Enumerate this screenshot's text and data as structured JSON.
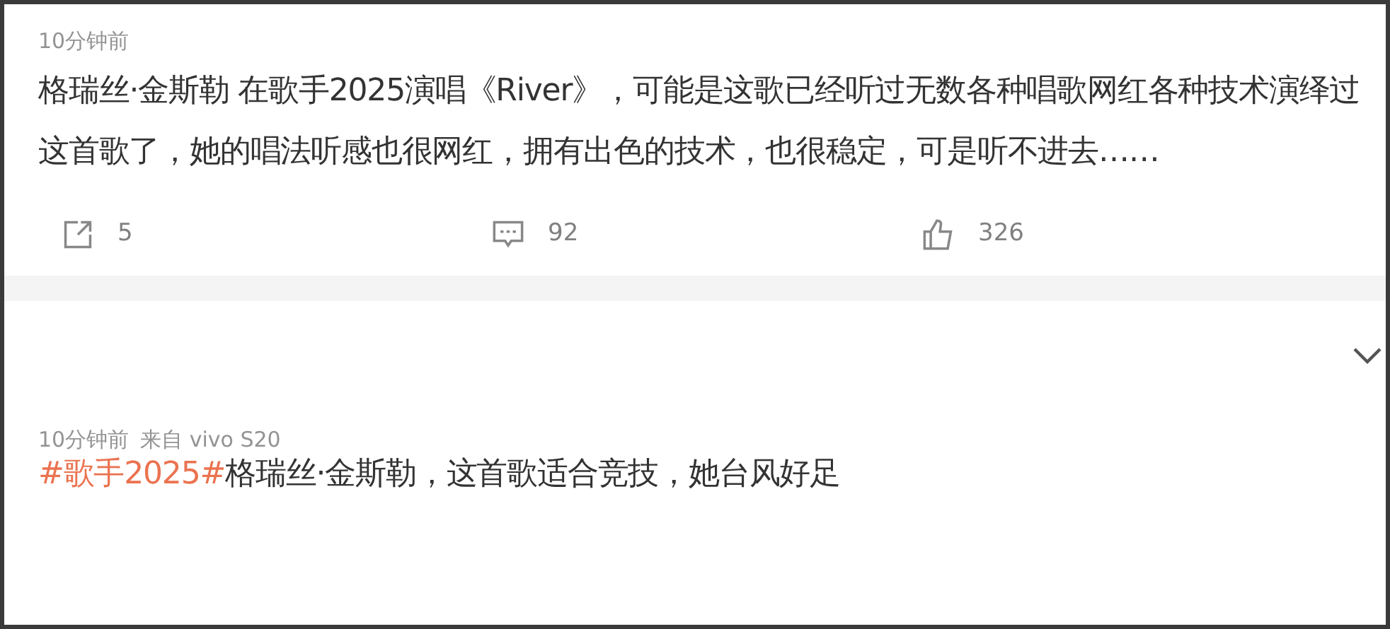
{
  "posts": [
    {
      "time": "10分钟前",
      "text": "格瑞丝·金斯勒 在歌手2025演唱《River》，可能是这歌已经听过无数各种唱歌网红各种技术演绎过这首歌了，她的唱法听感也很网红，拥有出色的技术，也很稳定，可是听不进去……",
      "actions": [
        {
          "kind": "share",
          "count": "5"
        },
        {
          "kind": "comment",
          "count": "92"
        },
        {
          "kind": "like",
          "count": "326"
        }
      ]
    },
    {
      "time": "10分钟前",
      "source": "来自 vivo S20",
      "topic": "#歌手2025#",
      "text": "格瑞丝·金斯勒，这首歌适合竞技，她台风好足"
    }
  ]
}
